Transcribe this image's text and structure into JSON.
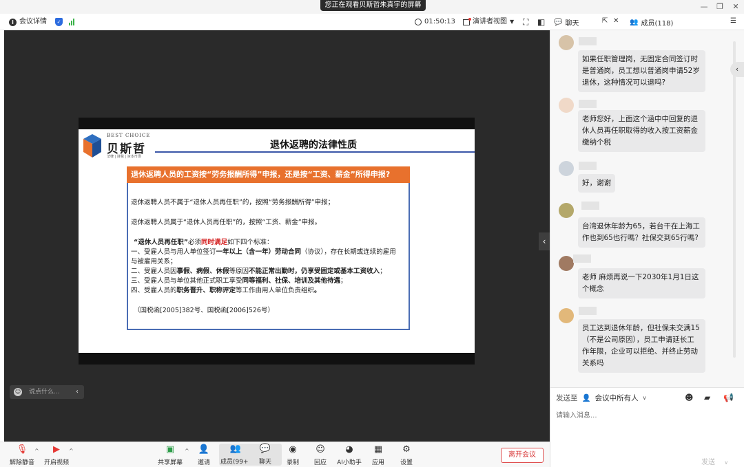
{
  "titlebar": {
    "share_banner": "您正在观看贝斯哲朱真宇的屏幕",
    "window_buttons": [
      "—",
      "❐",
      "✕"
    ]
  },
  "toolbar": {
    "meeting_details": "会议详情",
    "timer": "01:50:13",
    "view_mode": "演讲者视图"
  },
  "slide": {
    "logo_en": "BEST CHOICE",
    "logo_cn": "贝斯哲",
    "logo_tag": "法律 | 财税 | 资本市场",
    "title": "退休返聘的法律性质",
    "banner": "退休返聘人员的工资按“劳务报酬所得”申报，还是按“工资、薪金”所得申报?",
    "line1": "退休返聘人员不属于“退休人员再任职”的，按照“劳务报酬所得”申报；",
    "line2": "退休返聘人员属于“退休人员再任职”的，按照“工资、薪金”申报。",
    "line3_a": "“退休人员再任职”",
    "line3_b": "必须",
    "line3_c": "同时满足",
    "line3_d": "如下四个标准：",
    "item1_a": "一、受雇人员与用人单位签订",
    "item1_b": "一年以上（含一年）劳动合同",
    "item1_c": "（协议），存在长期或连续的雇用",
    "item1_d": "与被雇用关系；",
    "item2_a": "二、受雇人员因",
    "item2_b": "事假、病假、休假",
    "item2_c": "等原因",
    "item2_d": "不能正常出勤时，仍享受固定或基本工资收入",
    "item2_e": "；",
    "item3_a": "三、受雇人员与单位其他正式职工享受",
    "item3_b": "同等福利、社保、培训及其他待遇",
    "item3_c": "；",
    "item4_a": "四、受雇人员的",
    "item4_b": "职务晋升、职称评定",
    "item4_c": "等工作由用人单位负责组织",
    "item4_d": "。",
    "reference": "（国税函[2005]382号、国税函[2006]526号）"
  },
  "stage": {
    "say_placeholder": "说点什么..."
  },
  "bottombar": {
    "mute": "解除静音",
    "video": "开启视频",
    "share": "共享屏幕",
    "invite": "邀请",
    "members": "成员(99+)",
    "chat": "聊天",
    "record": "录制",
    "replay": "回应",
    "ai": "AI小助手",
    "apps": "应用",
    "settings": "设置",
    "leave": "离开会议"
  },
  "panel": {
    "chat_tab": "聊天",
    "members_tab": "成员(118)",
    "messages": [
      {
        "text": "如果任职管理岗，无固定合同签订时是普通岗，员工想以普通岗申请52岁退休，这种情况可以退吗?"
      },
      {
        "text": "老师您好，上面这个涵中中回复的退休人员再任职取得的收入按工资薪金缴纳个税"
      },
      {
        "text": "好，谢谢"
      },
      {
        "text": "台湾退休年龄为65，若台干在上海工作也到65也行嗎？社保交到65行嗎?"
      },
      {
        "text": "老师 麻烦再说一下2030年1月1日这个概念"
      },
      {
        "text": "员工达到退休年龄，但社保未交满15（不是公司原因），员工申请延长工作年限，企业可以拒绝、并终止劳动关系吗"
      }
    ],
    "send_to_label": "发送至",
    "send_to_value": "会议中所有人",
    "input_placeholder": "请输入消息...",
    "send": "发送"
  }
}
